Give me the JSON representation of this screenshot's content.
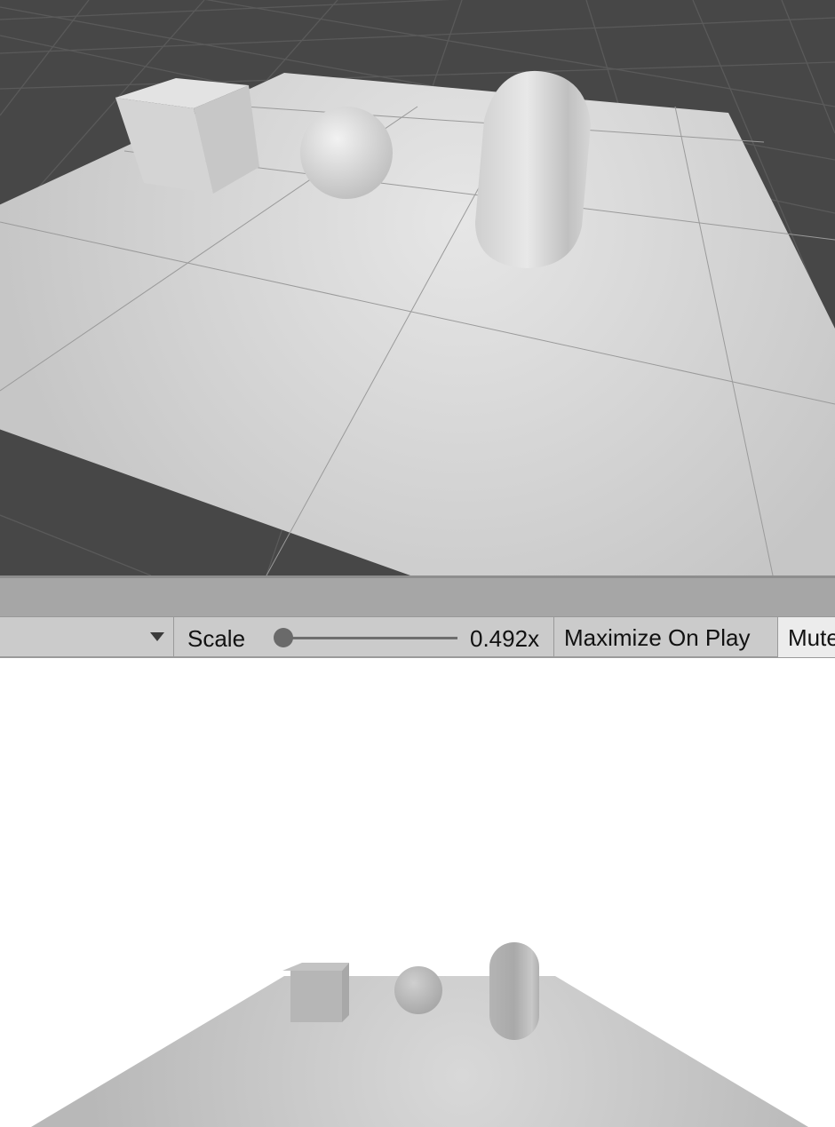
{
  "scene_view": {
    "objects": [
      "cube-object",
      "sphere-object",
      "capsule-object",
      "plane-object"
    ],
    "colors": {
      "background": "#474747",
      "ground": "#d8d8d8",
      "grid": "#8a8a8a"
    }
  },
  "toolbar": {
    "display_dropdown_value": "",
    "scale_label": "Scale",
    "scale_value": "0.492x",
    "scale_fraction": 0.05,
    "maximize_label": "Maximize On Play",
    "mute_label": "Mute Audio"
  },
  "game_view": {
    "objects": [
      "cube-object",
      "sphere-object",
      "capsule-object",
      "plane-object"
    ],
    "colors": {
      "background": "#ffffff",
      "ground": "#c4c4c4"
    }
  }
}
